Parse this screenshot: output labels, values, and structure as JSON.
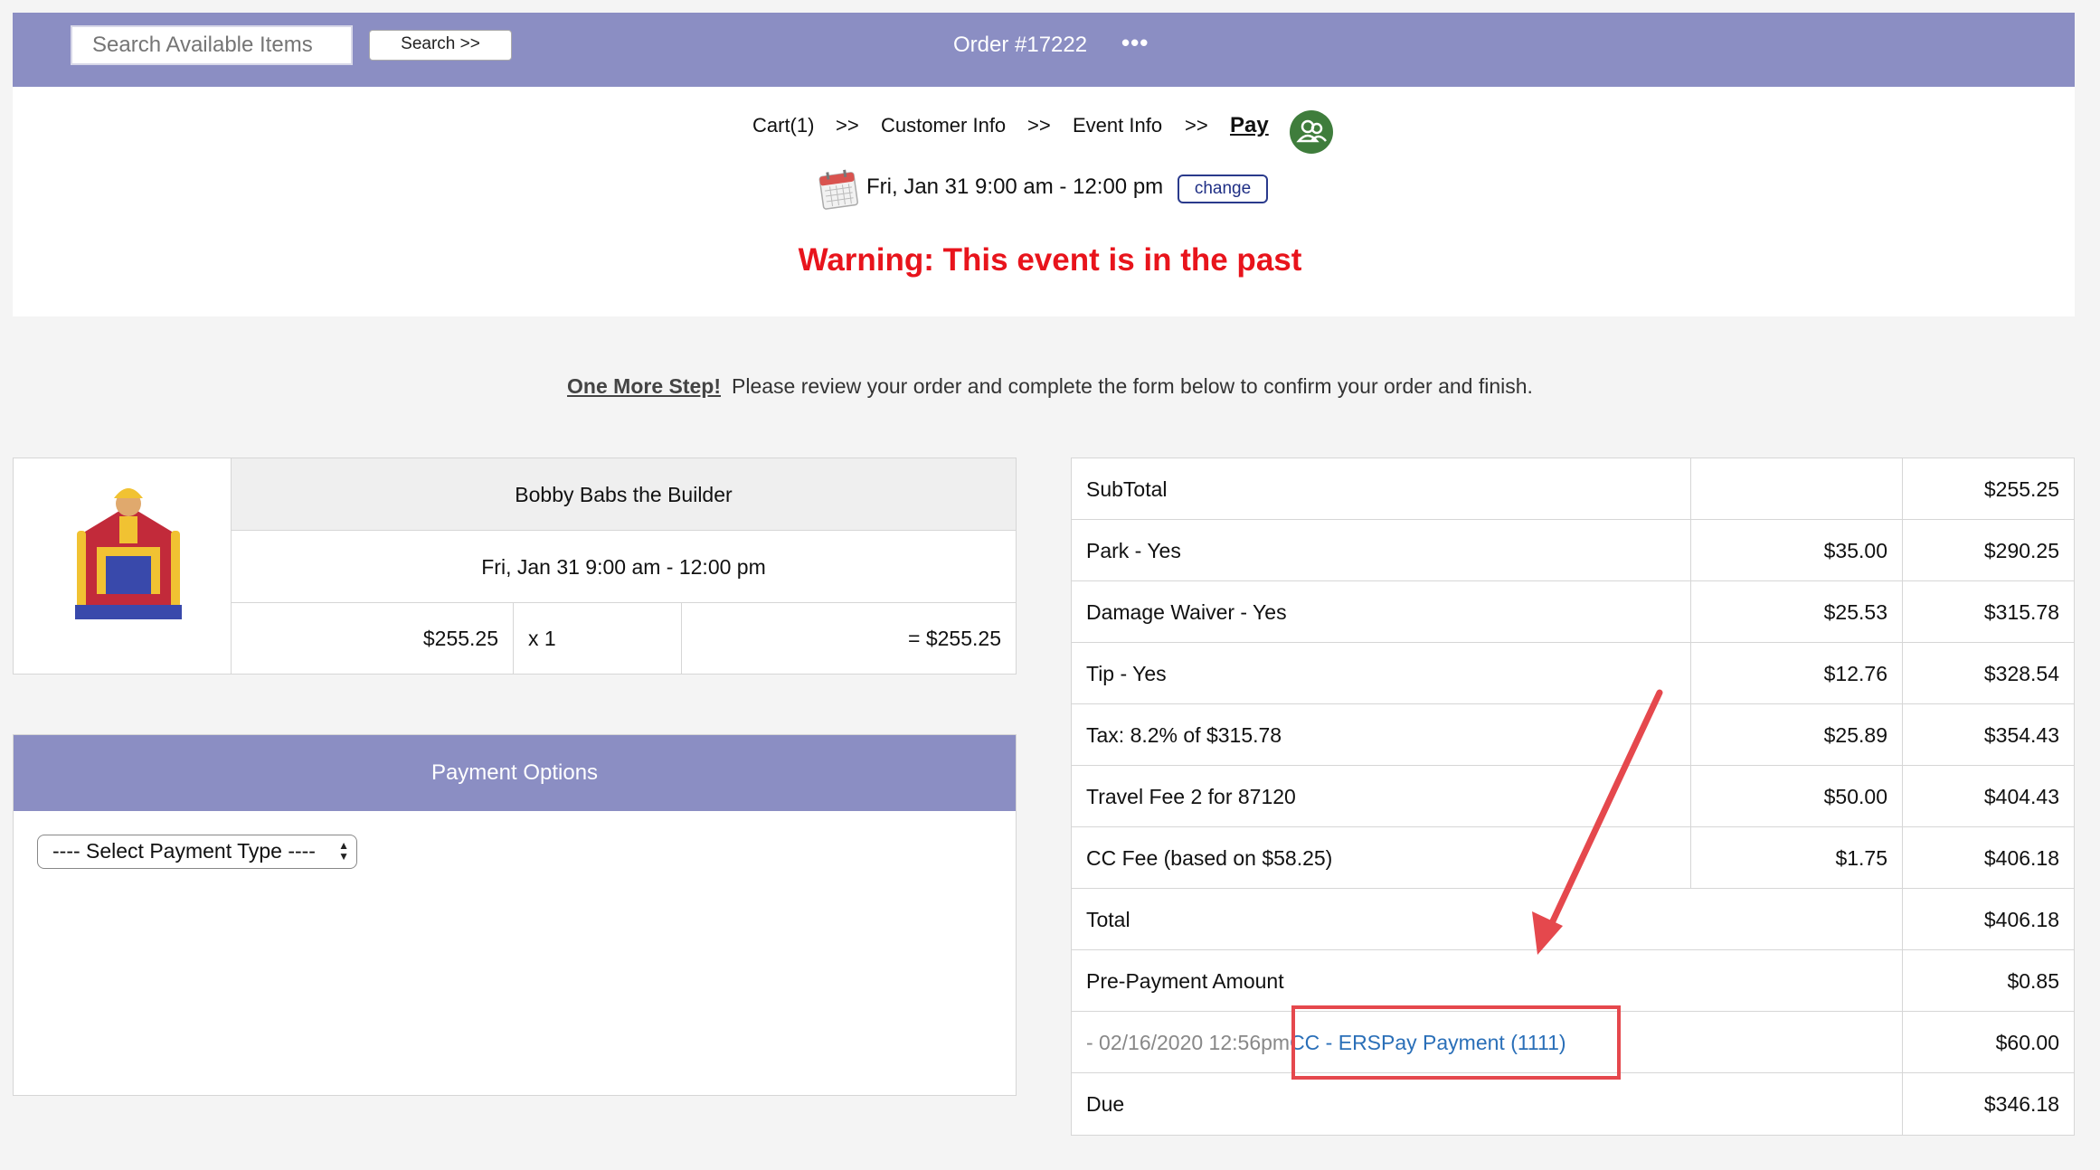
{
  "topbar": {
    "search_placeholder": "Search Available Items",
    "search_button": "Search >>",
    "order_title": "Order #17222",
    "more_label": "•••",
    "bg_color": "#8b8ec3"
  },
  "breadcrumb": {
    "items": [
      {
        "label": "Cart(1)"
      },
      {
        "label": ">>"
      },
      {
        "label": "Customer Info"
      },
      {
        "label": ">>"
      },
      {
        "label": "Event Info"
      },
      {
        "label": ">>"
      },
      {
        "label": "Pay"
      }
    ],
    "icon": "people-icon"
  },
  "event": {
    "date_range": "Fri, Jan 31 9:00 am - 12:00 pm",
    "change_label": "change",
    "icon": "calendar-icon"
  },
  "warning": "Warning: This event is in the past",
  "instructions": {
    "strong": "One More Step!",
    "text": "Please review your order and complete the form below to confirm your order and finish."
  },
  "item": {
    "name": "Bobby Babs the Builder",
    "date_range": "Fri, Jan 31 9:00 am - 12:00 pm",
    "price": "$255.25",
    "qty": "x  1",
    "total": "= $255.25",
    "image": "bounce-house-image"
  },
  "payment_options": {
    "header": "Payment Options",
    "select_value": "---- Select Payment Type ----"
  },
  "totals": {
    "rows": [
      {
        "label": "SubTotal",
        "amount": "",
        "running": "$255.25"
      },
      {
        "label": "Park - Yes",
        "amount": "$35.00",
        "running": "$290.25"
      },
      {
        "label": "Damage Waiver - Yes",
        "amount": "$25.53",
        "running": "$315.78"
      },
      {
        "label": "Tip - Yes",
        "amount": "$12.76",
        "running": "$328.54"
      },
      {
        "label": "Tax: 8.2% of $315.78",
        "amount": "$25.89",
        "running": "$354.43"
      },
      {
        "label": "Travel Fee 2 for 87120",
        "amount": "$50.00",
        "running": "$404.43"
      },
      {
        "label": "CC Fee (based on $58.25)",
        "amount": "$1.75",
        "running": "$406.18"
      }
    ],
    "total_label": "Total",
    "total_value": "$406.18",
    "prepay_label": "Pre-Payment Amount",
    "prepay_value": "$0.85",
    "payment_date": "- 02/16/2020 12:56pm",
    "payment_link": "CC - ERSPay Payment (1111)",
    "payment_value": "$60.00",
    "due_label": "Due",
    "due_value": "$346.18"
  },
  "annotation_color": "#e5484d"
}
